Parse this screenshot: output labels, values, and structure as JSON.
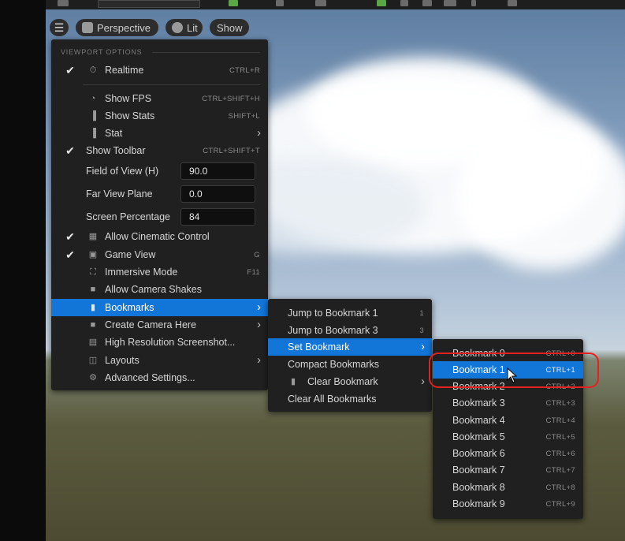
{
  "toolbar": {
    "perspective_label": "Perspective",
    "lit_label": "Lit",
    "show_label": "Show"
  },
  "viewport_menu": {
    "header": "VIEWPORT OPTIONS",
    "realtime": {
      "label": "Realtime",
      "shortcut": "CTRL+R",
      "checked": true
    },
    "show_fps": {
      "label": "Show FPS",
      "shortcut": "CTRL+SHIFT+H"
    },
    "show_stats": {
      "label": "Show Stats",
      "shortcut": "SHIFT+L"
    },
    "stat": {
      "label": "Stat"
    },
    "show_toolbar": {
      "label": "Show Toolbar",
      "shortcut": "CTRL+SHIFT+T",
      "checked": true
    },
    "fov": {
      "label": "Field of View (H)",
      "value": "90.0"
    },
    "far_view": {
      "label": "Far View Plane",
      "value": "0.0"
    },
    "screen_pct": {
      "label": "Screen Percentage",
      "value": "84"
    },
    "cinematic": {
      "label": "Allow Cinematic Control",
      "checked": true
    },
    "game_view": {
      "label": "Game View",
      "shortcut": "G",
      "checked": true
    },
    "immersive": {
      "label": "Immersive Mode",
      "shortcut": "F11"
    },
    "camera_shakes": {
      "label": "Allow Camera Shakes"
    },
    "bookmarks": {
      "label": "Bookmarks"
    },
    "create_camera": {
      "label": "Create Camera Here"
    },
    "hi_res": {
      "label": "High Resolution Screenshot..."
    },
    "layouts": {
      "label": "Layouts"
    },
    "advanced": {
      "label": "Advanced Settings..."
    }
  },
  "bookmarks_menu": {
    "jump1": {
      "label": "Jump to Bookmark 1",
      "shortcut": "1"
    },
    "jump3": {
      "label": "Jump to Bookmark 3",
      "shortcut": "3"
    },
    "set": {
      "label": "Set Bookmark"
    },
    "compact": {
      "label": "Compact Bookmarks"
    },
    "clear": {
      "label": "Clear Bookmark"
    },
    "clear_all": {
      "label": "Clear All Bookmarks"
    }
  },
  "set_bookmark_menu": {
    "items": [
      {
        "label": "Bookmark 0",
        "shortcut": "CTRL+0"
      },
      {
        "label": "Bookmark 1",
        "shortcut": "CTRL+1"
      },
      {
        "label": "Bookmark 2",
        "shortcut": "CTRL+2"
      },
      {
        "label": "Bookmark 3",
        "shortcut": "CTRL+3"
      },
      {
        "label": "Bookmark 4",
        "shortcut": "CTRL+4"
      },
      {
        "label": "Bookmark 5",
        "shortcut": "CTRL+5"
      },
      {
        "label": "Bookmark 6",
        "shortcut": "CTRL+6"
      },
      {
        "label": "Bookmark 7",
        "shortcut": "CTRL+7"
      },
      {
        "label": "Bookmark 8",
        "shortcut": "CTRL+8"
      },
      {
        "label": "Bookmark 9",
        "shortcut": "CTRL+9"
      }
    ],
    "selected_index": 1
  },
  "colors": {
    "accent": "#1275d8",
    "annotation": "#e3211e",
    "menu_bg": "#202020"
  }
}
